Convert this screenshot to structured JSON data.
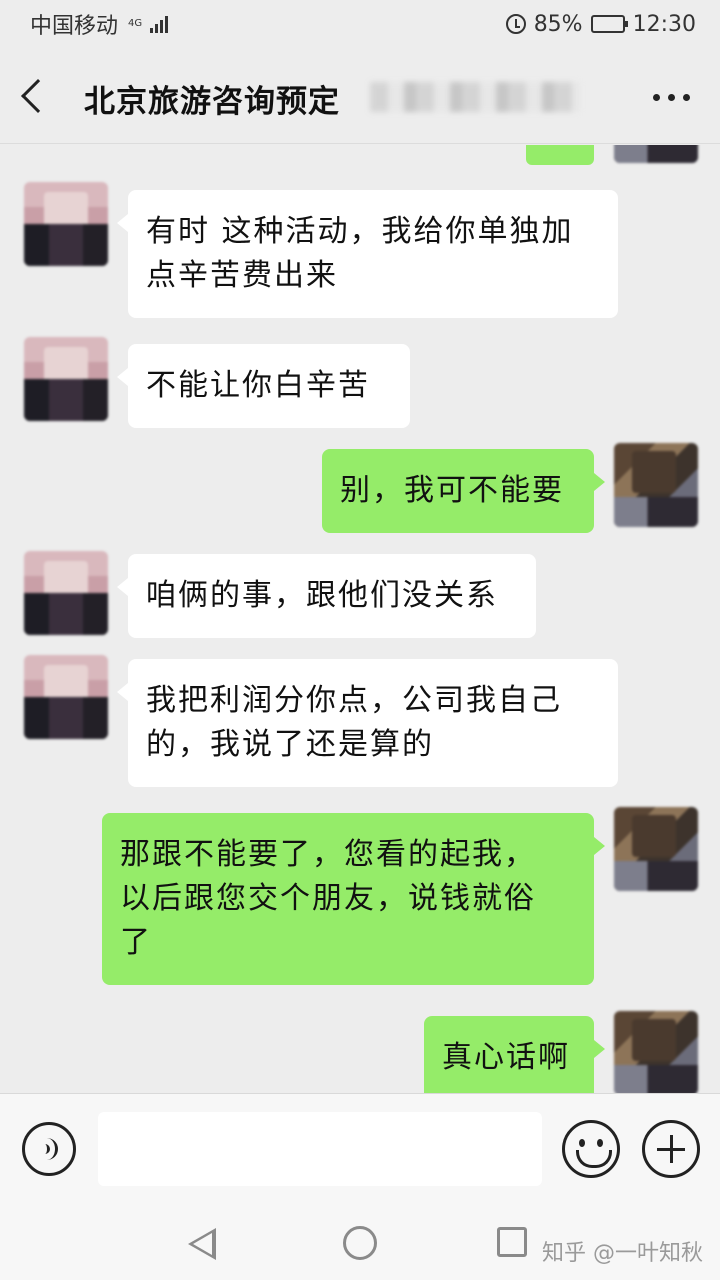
{
  "status_bar": {
    "carrier": "中国移动",
    "network": "4G",
    "battery": "85%",
    "time": "12:30"
  },
  "header": {
    "title": "北京旅游咨询预定",
    "more": "..."
  },
  "messages": [
    {
      "side": "other",
      "lines": [
        "有时 这种活动，我给你单独加",
        "点辛苦费出来"
      ]
    },
    {
      "side": "other",
      "lines": [
        "不能让你白辛苦"
      ]
    },
    {
      "side": "self",
      "lines": [
        "别，我可不能要"
      ]
    },
    {
      "side": "other",
      "lines": [
        "咱俩的事，跟他们没关系"
      ]
    },
    {
      "side": "other",
      "lines": [
        "我把利润分你点，公司我自己",
        "的，我说了还是算的"
      ]
    },
    {
      "side": "self",
      "lines": [
        "那跟不能要了，您看的起我，",
        "以后跟您交个朋友，说钱就俗",
        "了"
      ]
    },
    {
      "side": "self",
      "lines": [
        "真心话啊"
      ]
    }
  ],
  "input_bar": {
    "placeholder": ""
  },
  "watermark": "知乎 @一叶知秋",
  "colors": {
    "self_bubble": "#95ec69",
    "other_bubble": "#ffffff",
    "background": "#ededed"
  }
}
